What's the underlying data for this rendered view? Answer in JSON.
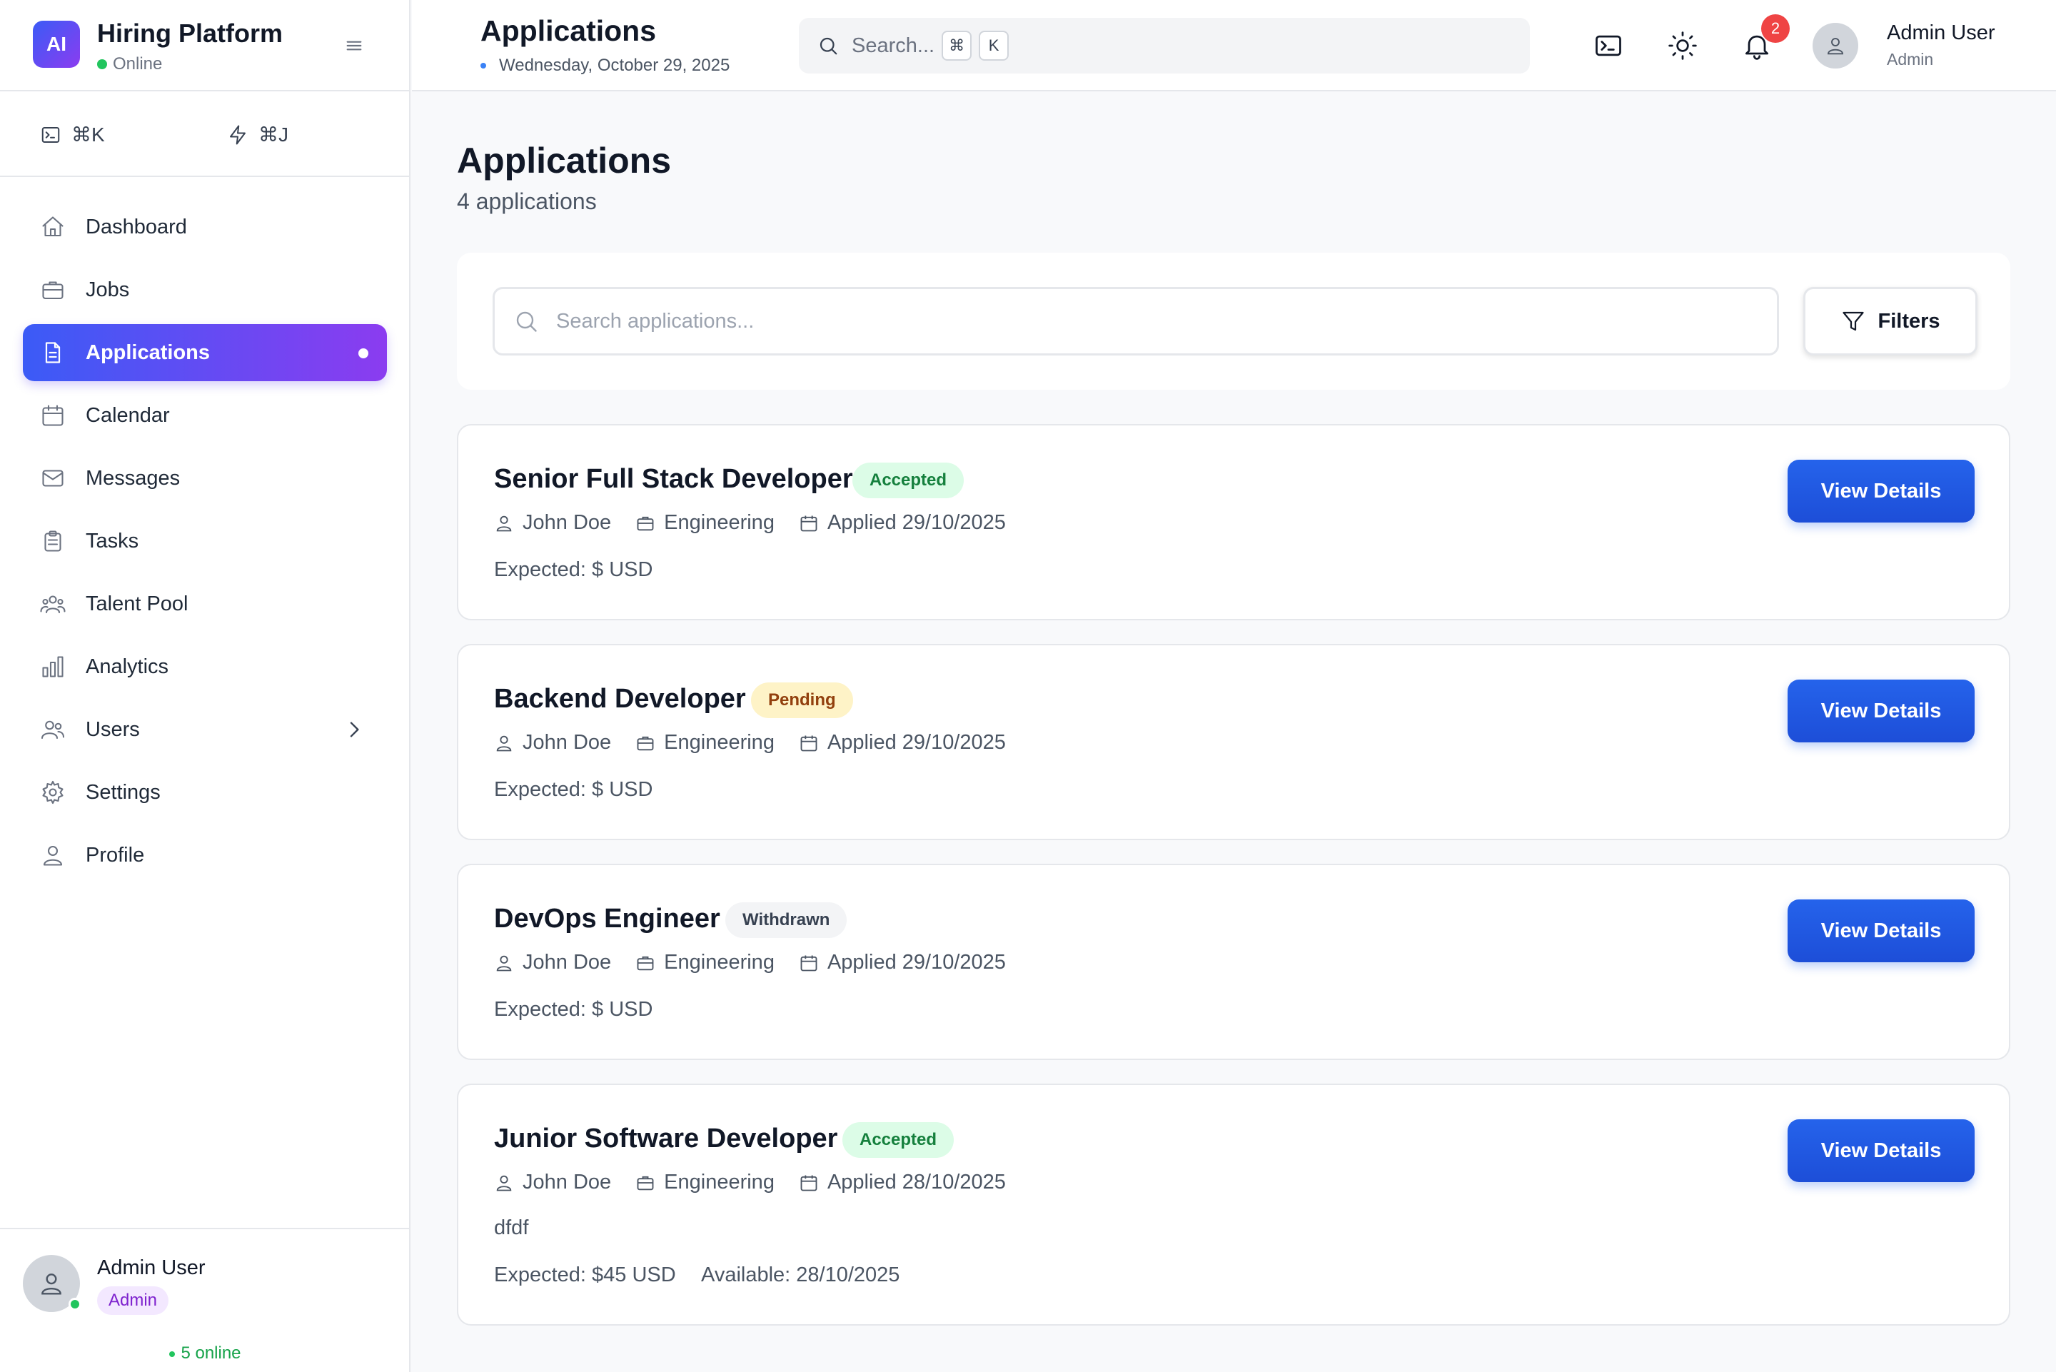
{
  "brand": {
    "logo": "AI",
    "title": "Hiring Platform",
    "status": "Online"
  },
  "shortcuts": [
    {
      "icon": "terminal-icon",
      "label": "⌘K"
    },
    {
      "icon": "lightning-icon",
      "label": "⌘J"
    }
  ],
  "nav": {
    "items": [
      {
        "label": "Dashboard",
        "icon": "home-icon"
      },
      {
        "label": "Jobs",
        "icon": "briefcase-icon"
      },
      {
        "label": "Applications",
        "icon": "file-icon",
        "active": true
      },
      {
        "label": "Calendar",
        "icon": "calendar-icon"
      },
      {
        "label": "Messages",
        "icon": "mail-icon"
      },
      {
        "label": "Tasks",
        "icon": "clipboard-icon"
      },
      {
        "label": "Talent Pool",
        "icon": "users-group-icon"
      },
      {
        "label": "Analytics",
        "icon": "bar-chart-icon"
      },
      {
        "label": "Users",
        "icon": "users-icon",
        "has_submenu": true
      },
      {
        "label": "Settings",
        "icon": "gear-icon"
      },
      {
        "label": "Profile",
        "icon": "user-icon"
      }
    ]
  },
  "sidebar_footer": {
    "name": "Admin User",
    "role": "Admin",
    "online": "5 online"
  },
  "topbar": {
    "title": "Applications",
    "date": "Wednesday, October 29, 2025",
    "search_placeholder": "Search...",
    "search_keys": [
      "⌘",
      "K"
    ],
    "notification_count": "2",
    "user_name": "Admin User",
    "user_role": "Admin"
  },
  "page": {
    "title": "Applications",
    "count": "4 applications",
    "search_placeholder": "Search applications...",
    "filters_label": "Filters",
    "view_label": "View Details"
  },
  "applications": [
    {
      "title": "Senior Full Stack Developer",
      "status": "Accepted",
      "candidate": "John Doe",
      "department": "Engineering",
      "applied": "Applied 29/10/2025",
      "expected": "Expected: $ USD"
    },
    {
      "title": "Backend Developer",
      "status": "Pending",
      "candidate": "John Doe",
      "department": "Engineering",
      "applied": "Applied 29/10/2025",
      "expected": "Expected: $ USD"
    },
    {
      "title": "DevOps Engineer",
      "status": "Withdrawn",
      "candidate": "John Doe",
      "department": "Engineering",
      "applied": "Applied 29/10/2025",
      "expected": "Expected: $ USD"
    },
    {
      "title": "Junior Software Developer",
      "status": "Accepted",
      "candidate": "John Doe",
      "department": "Engineering",
      "applied": "Applied 28/10/2025",
      "note": "dfdf",
      "expected": "Expected: $45 USD",
      "available": "Available: 28/10/2025"
    }
  ],
  "colors": {
    "accent_start": "#3b5bf6",
    "accent_end": "#8b3cf0",
    "primary_button": "#1d4ed8"
  }
}
